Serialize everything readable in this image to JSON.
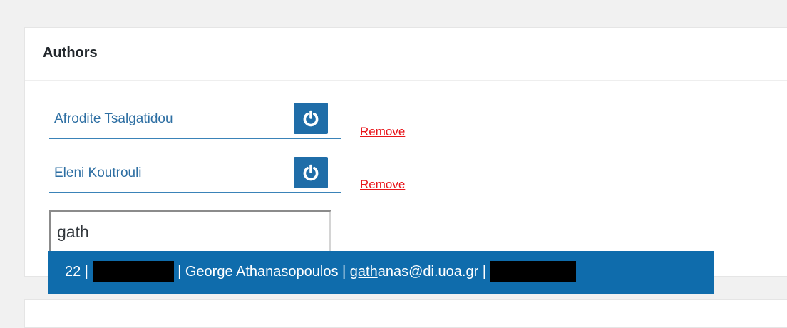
{
  "panel": {
    "title": "Authors"
  },
  "authors": [
    {
      "name": "Afrodite Tsalgatidou",
      "remove_label": "Remove",
      "power_icon": "power-icon"
    },
    {
      "name": "Eleni Koutrouli",
      "remove_label": "Remove",
      "power_icon": "power-icon"
    }
  ],
  "search": {
    "value": "gath",
    "placeholder": ""
  },
  "autocomplete": {
    "items": [
      {
        "id_prefix": "22 | ",
        "separator_a": " | ",
        "name": "George Athanasopoulos",
        "separator_b": " | ",
        "email_match": "gath",
        "email_rest": "anas@di.uoa.gr",
        "separator_c": " | ",
        "redacted_fields": 2
      }
    ]
  },
  "colors": {
    "accent": "#1f6da8",
    "dropdown_bg": "#0f6cac",
    "link_remove": "#e8161b",
    "author_text": "#2e6fa3"
  }
}
